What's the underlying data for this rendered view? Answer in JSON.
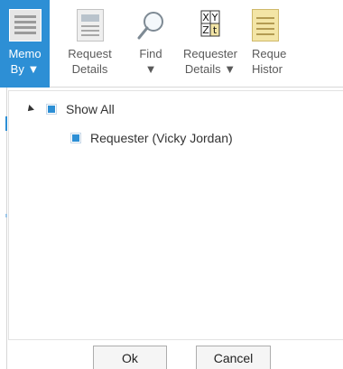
{
  "ribbon": {
    "memo_by": {
      "line1": "Memo",
      "line2": "By ▼",
      "icon": "memo-list-icon"
    },
    "request_details": {
      "line1": "Request",
      "line2": "Details",
      "icon": "document-icon"
    },
    "find": {
      "line1": "Find",
      "line2": "▼",
      "icon": "magnifier-icon"
    },
    "requester_details": {
      "line1": "Requester",
      "line2": "Details ▼",
      "icon": "xyz-icon"
    },
    "request_history": {
      "line1": "Reque",
      "line2": "Histor",
      "icon": "notes-icon"
    }
  },
  "tree": {
    "root": {
      "label": "Show All",
      "checked": true,
      "expanded": true
    },
    "child": {
      "label": "Requester (Vicky Jordan)",
      "checked": true
    }
  },
  "buttons": {
    "ok": "Ok",
    "cancel": "Cancel"
  },
  "colors": {
    "accent": "#2d8fd5"
  }
}
